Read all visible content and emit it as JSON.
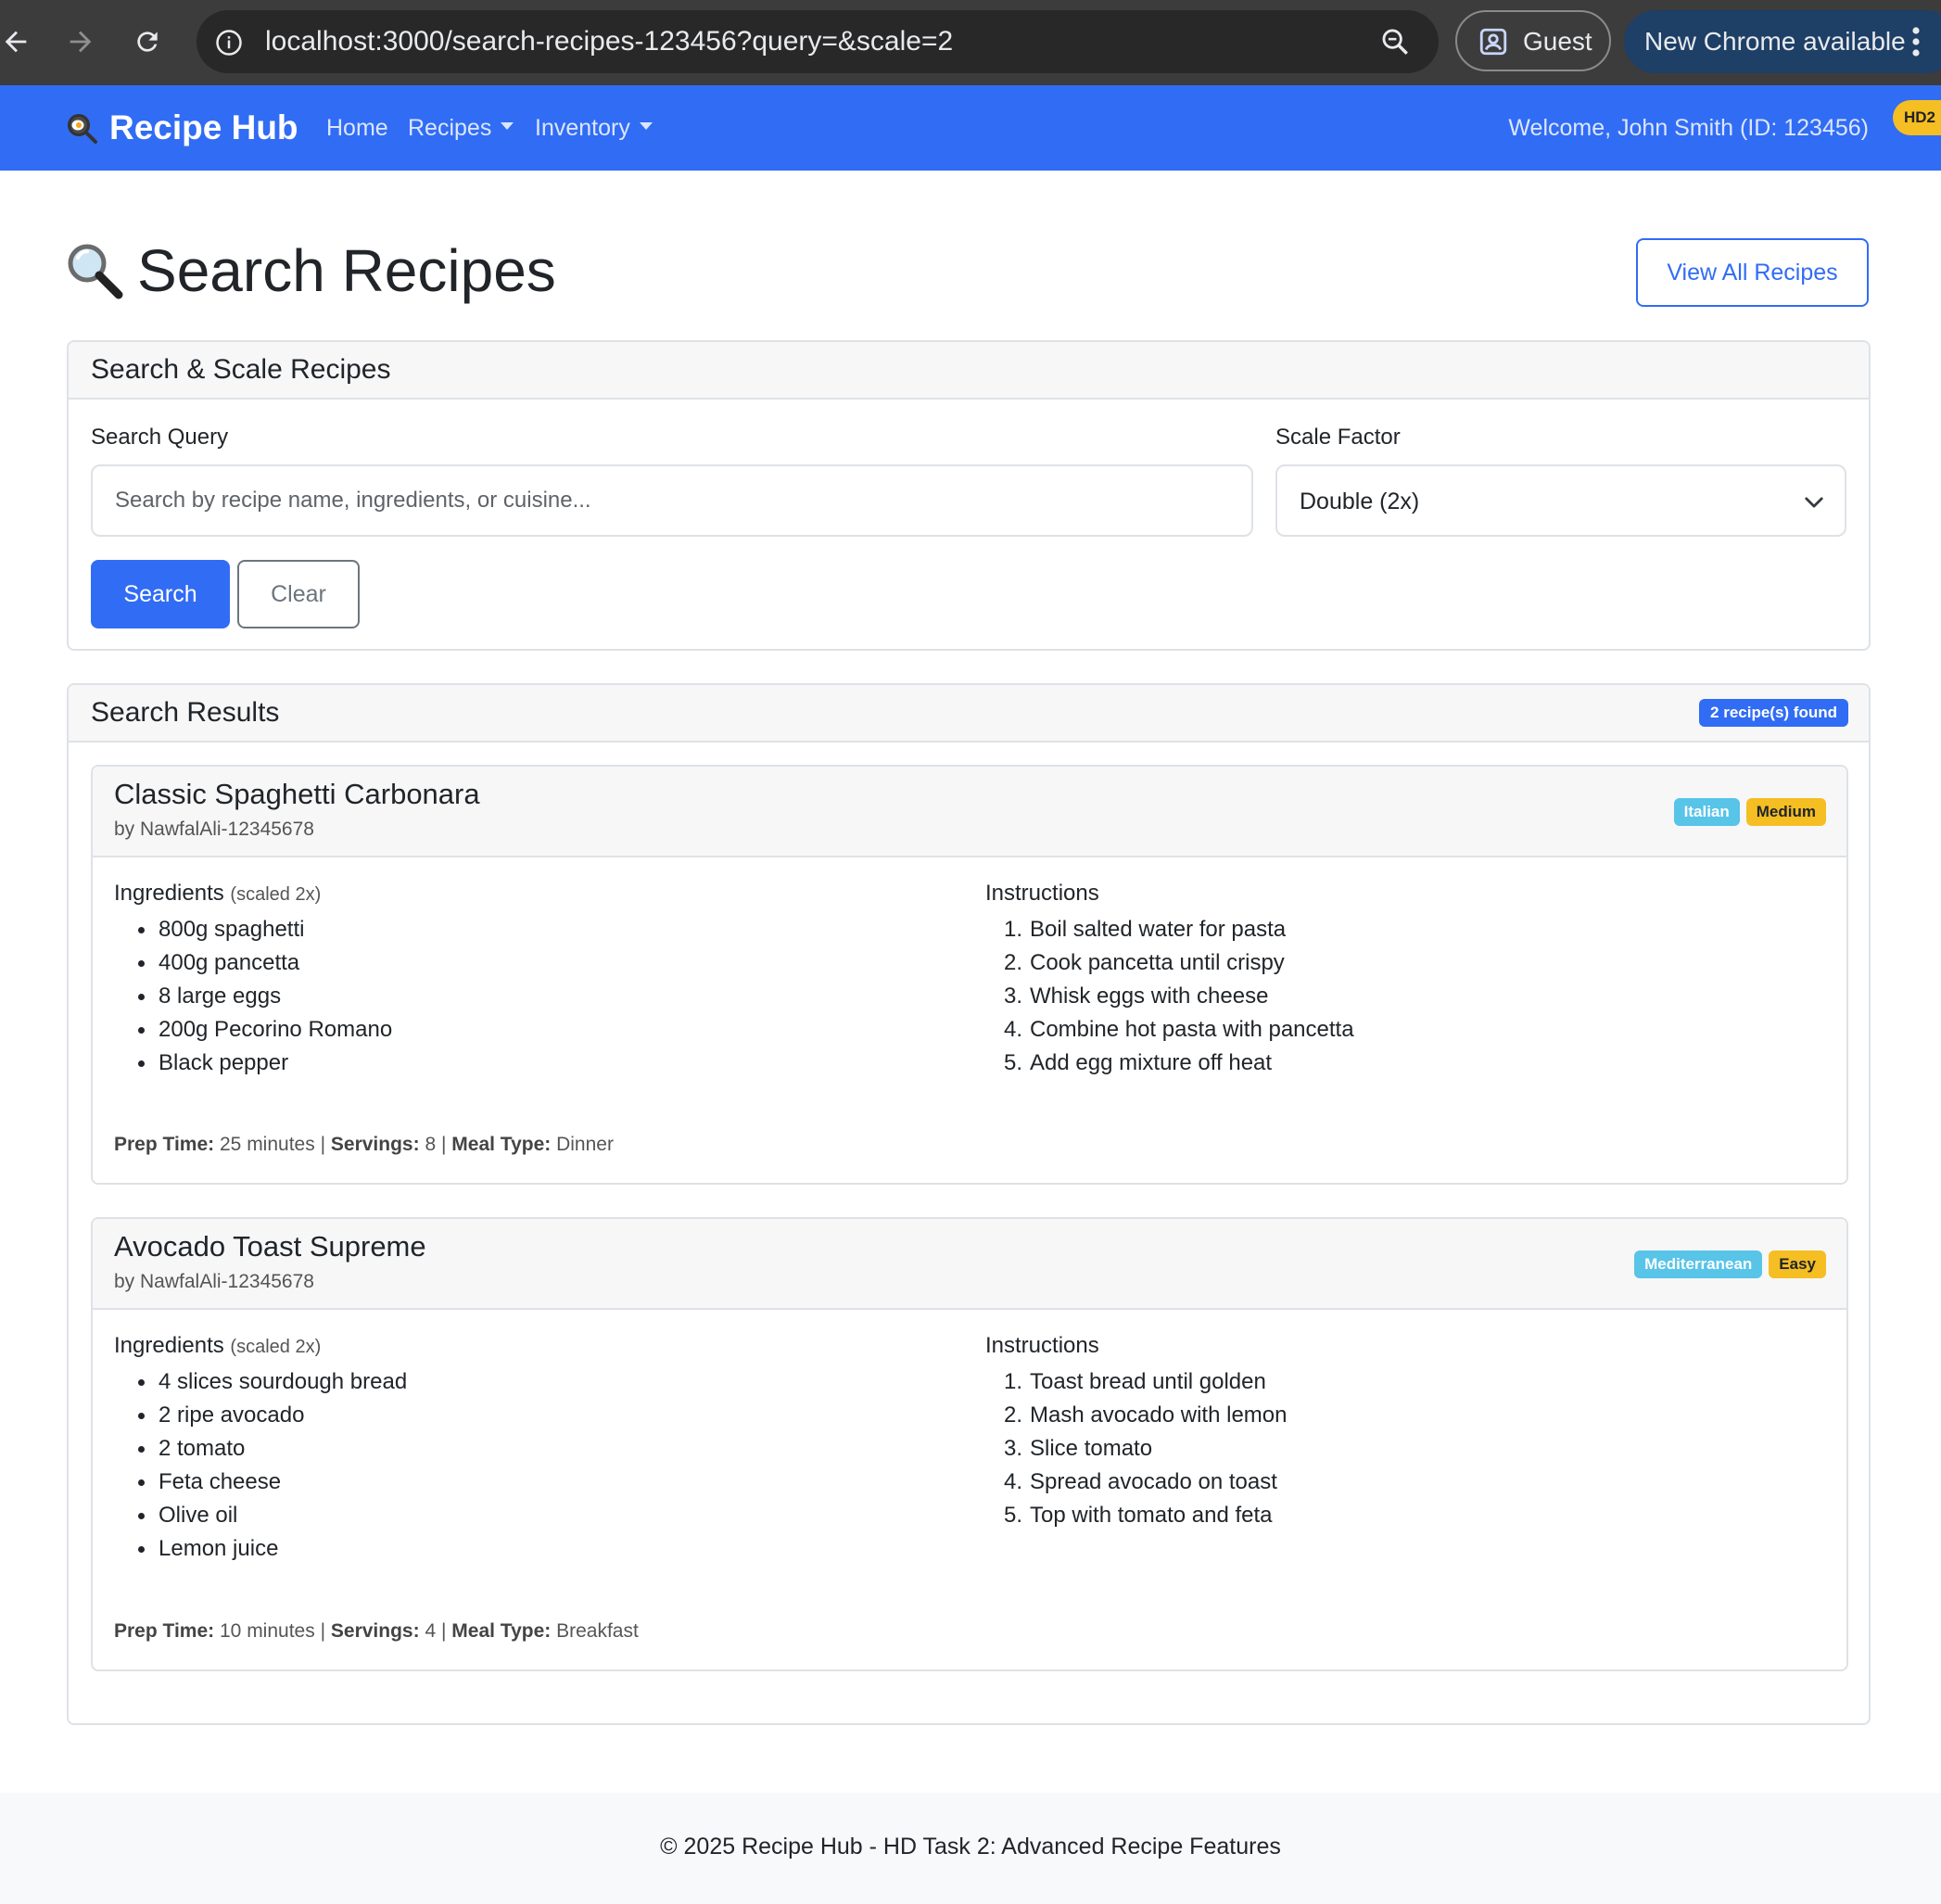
{
  "browser": {
    "url": "localhost:3000/search-recipes-123456?query=&scale=2",
    "guest_label": "Guest",
    "update_label": "New Chrome available"
  },
  "navbar": {
    "brand": "Recipe Hub",
    "links": [
      {
        "label": "Home"
      },
      {
        "label": "Recipes"
      },
      {
        "label": "Inventory"
      }
    ],
    "welcome": "Welcome, John Smith (ID: 123456)",
    "badge": "HD2"
  },
  "page": {
    "title": "Search Recipes",
    "view_all_label": "View All Recipes"
  },
  "search_card": {
    "title": "Search & Scale Recipes",
    "query_label": "Search Query",
    "query_value": "",
    "query_placeholder": "Search by recipe name, ingredients, or cuisine...",
    "scale_label": "Scale Factor",
    "scale_value": "Double (2x)",
    "search_button": "Search",
    "clear_button": "Clear"
  },
  "results": {
    "title": "Search Results",
    "count_badge": "2 recipe(s) found",
    "ingredients_title": "Ingredients",
    "scaled_note": "(scaled 2x)",
    "instructions_title": "Instructions",
    "prep_label": "Prep Time:",
    "servings_label": "Servings:",
    "meal_label": "Meal Type:",
    "sep": "|",
    "recipes": [
      {
        "title": "Classic Spaghetti Carbonara",
        "author": "by NawfalAli-12345678",
        "cuisine": "Italian",
        "difficulty": "Medium",
        "ingredients": [
          "800g spaghetti",
          "400g pancetta",
          "8 large eggs",
          "200g Pecorino Romano",
          "Black pepper"
        ],
        "instructions": [
          "Boil salted water for pasta",
          "Cook pancetta until crispy",
          "Whisk eggs with cheese",
          "Combine hot pasta with pancetta",
          "Add egg mixture off heat"
        ],
        "prep_time": "25 minutes",
        "servings": "8",
        "meal_type": "Dinner"
      },
      {
        "title": "Avocado Toast Supreme",
        "author": "by NawfalAli-12345678",
        "cuisine": "Mediterranean",
        "difficulty": "Easy",
        "ingredients": [
          "4 slices sourdough bread",
          "2 ripe avocado",
          "2 tomato",
          "Feta cheese",
          "Olive oil",
          "Lemon juice"
        ],
        "instructions": [
          "Toast bread until golden",
          "Mash avocado with lemon",
          "Slice tomato",
          "Spread avocado on toast",
          "Top with tomato and feta"
        ],
        "prep_time": "10 minutes",
        "servings": "4",
        "meal_type": "Breakfast"
      }
    ]
  },
  "footer": {
    "text": "© 2025 Recipe Hub - HD Task 2: Advanced Recipe Features"
  },
  "colors": {
    "primary": "#316cf4",
    "cuisine_badge": "#57c4e8",
    "difficulty_badge": "#f5be22"
  }
}
